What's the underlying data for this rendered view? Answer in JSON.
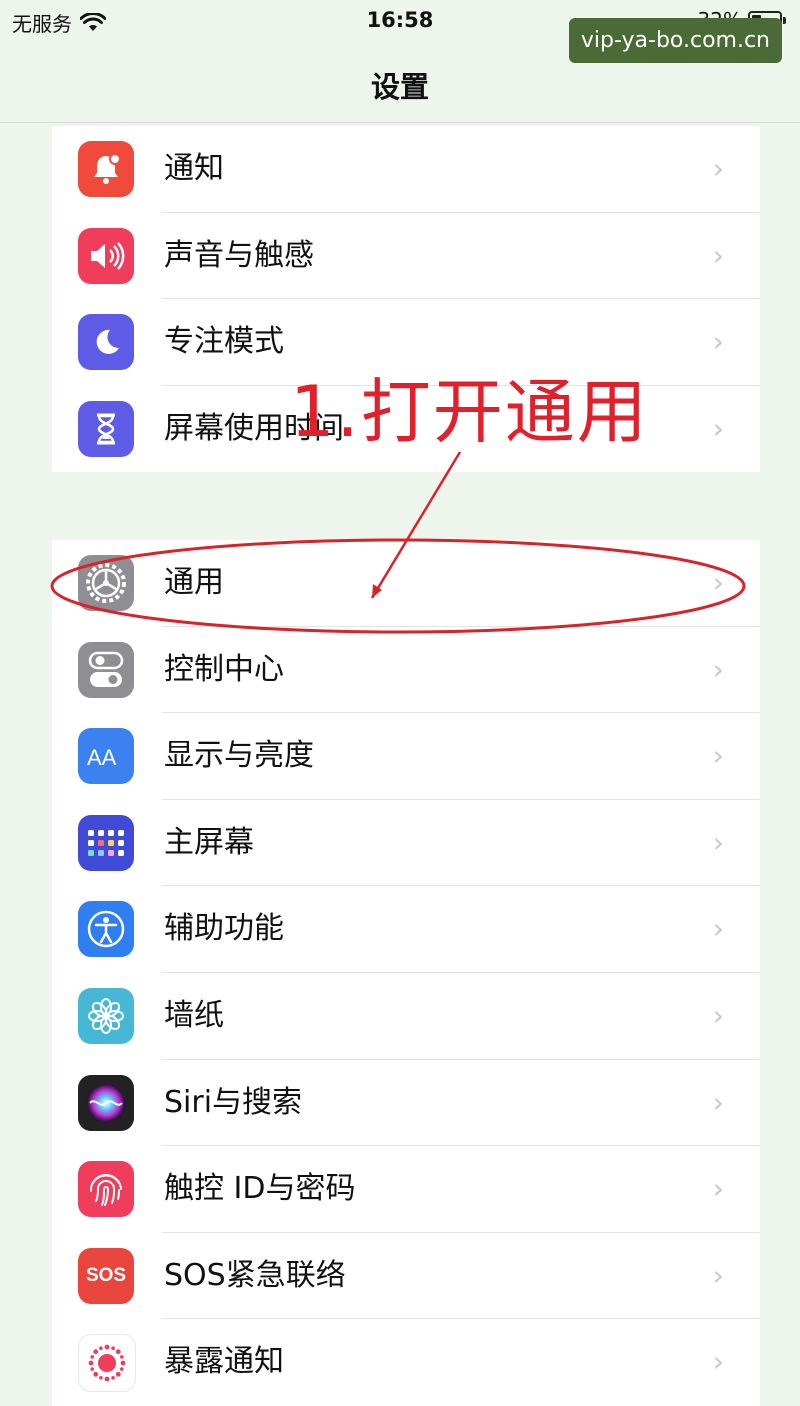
{
  "status_bar": {
    "carrier": "无服务",
    "time": "16:58",
    "battery": "32%"
  },
  "nav": {
    "title": "设置"
  },
  "watermark": "vip-ya-bo.com.cn",
  "annotation": "1.打开通用",
  "groups": [
    {
      "items": [
        {
          "label": "通知",
          "icon": "notifications-icon",
          "color": "#f04a3c"
        },
        {
          "label": "声音与触感",
          "icon": "sound-icon",
          "color": "#ef3d5b"
        },
        {
          "label": "专注模式",
          "icon": "moon-icon",
          "color": "#5e5ce6"
        },
        {
          "label": "屏幕使用时间",
          "icon": "hourglass-icon",
          "color": "#5e5ce6"
        }
      ]
    },
    {
      "items": [
        {
          "label": "通用",
          "icon": "gear-icon",
          "color": "#8e8e93"
        },
        {
          "label": "控制中心",
          "icon": "toggles-icon",
          "color": "#8e8e93"
        },
        {
          "label": "显示与亮度",
          "icon": "text-size-icon",
          "color": "#3b82f0"
        },
        {
          "label": "主屏幕",
          "icon": "home-grid-icon",
          "color": "#3f4bd6"
        },
        {
          "label": "辅助功能",
          "icon": "accessibility-icon",
          "color": "#2f7ff0"
        },
        {
          "label": "墙纸",
          "icon": "flower-icon",
          "color": "#46b8d6"
        },
        {
          "label": "Siri与搜索",
          "icon": "siri-icon",
          "color": "#222222"
        },
        {
          "label": "触控 ID与密码",
          "icon": "fingerprint-icon",
          "color": "#ef3d5b"
        },
        {
          "label": "SOS紧急联络",
          "icon": "sos-icon",
          "color": "#e8453c",
          "icon_text": "SOS"
        },
        {
          "label": "暴露通知",
          "icon": "exposure-icon",
          "color": "#ffffff"
        }
      ]
    }
  ]
}
